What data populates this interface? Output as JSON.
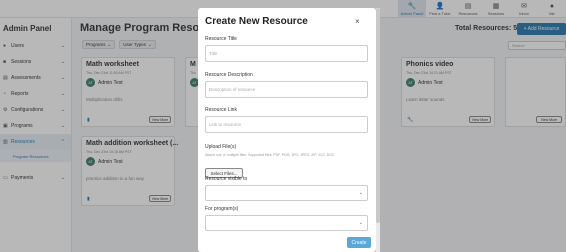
{
  "topnav": {
    "items": [
      {
        "label": "Admin Panel",
        "icon": "wrench-icon"
      },
      {
        "label": "Find a Tutor",
        "icon": "person-icon"
      },
      {
        "label": "Resources",
        "icon": "book-icon"
      },
      {
        "label": "Sessions",
        "icon": "calendar-icon"
      },
      {
        "label": "Inbox",
        "icon": "mail-icon"
      },
      {
        "label": "Me",
        "icon": "avatar-icon"
      }
    ]
  },
  "sidebar": {
    "title": "Admin Panel",
    "items": [
      {
        "label": "Users",
        "icon": "users-icon"
      },
      {
        "label": "Sessions",
        "icon": "sessions-icon"
      },
      {
        "label": "Assessments",
        "icon": "assessment-icon"
      },
      {
        "label": "Reports",
        "icon": "reports-icon"
      },
      {
        "label": "Configurations",
        "icon": "config-icon"
      },
      {
        "label": "Programs",
        "icon": "programs-icon"
      },
      {
        "label": "Resources",
        "icon": "resources-icon"
      },
      {
        "label": "Payments",
        "icon": "payments-icon"
      }
    ],
    "sub_item": "Program Resources"
  },
  "main": {
    "title": "Manage Program Resource",
    "filters": [
      "Programs",
      "User Types"
    ],
    "total": "Total Resources: 5",
    "add_button": "+ Add Resource",
    "search_placeholder": "Search"
  },
  "cards": [
    {
      "title": "Math worksheet",
      "date": "Thu, Dec 23rd 11:50 AM PST",
      "avatar": "AT",
      "author": "Admin Test",
      "desc": "Multiplication drills",
      "view": "View More"
    },
    {
      "title": "Math addition worksheet (...",
      "date": "Thu, Dec 23rd 10:18 AM PST",
      "avatar": "AT",
      "author": "Admin Test",
      "desc": "practice addition in a fun way",
      "view": "View More"
    },
    {
      "title": "Phonics video",
      "date": "Thu, Dec 23rd 10:21 AM PST",
      "avatar": "AT",
      "author": "Admin Test",
      "desc": "Learn letter sounds",
      "view": "View More"
    },
    {
      "title": "M",
      "date": "Thu",
      "avatar": "AT",
      "author": "",
      "desc": "",
      "view": ""
    }
  ],
  "modal": {
    "title": "Create New Resource",
    "close": "×",
    "title_label": "Resource Title",
    "title_placeholder": "Title",
    "desc_label": "Resource Description",
    "desc_placeholder": "Description of resource",
    "link_label": "Resource Link",
    "link_placeholder": "Link to resource",
    "upload_label": "Upload File(s)",
    "upload_hint": "Attach one or multiple files. Supported files: PDF, PNG, JPG, JPEG, ZIP, XLS, DOC",
    "upload_button": "Select Files...",
    "visible_label": "Resource visible to",
    "program_label": "For program(s)",
    "create_button": "Create"
  }
}
